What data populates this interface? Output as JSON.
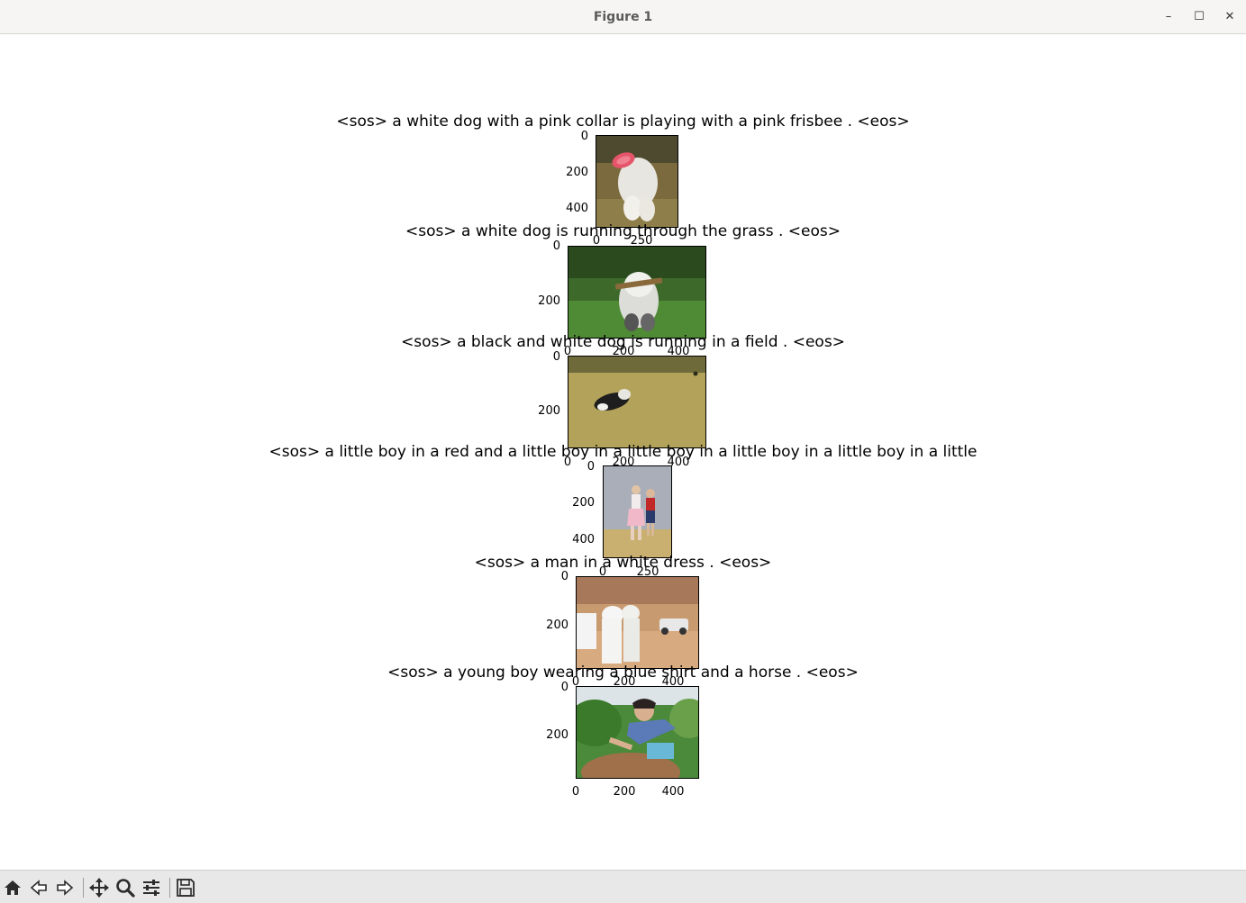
{
  "window": {
    "title": "Figure 1"
  },
  "window_controls": {
    "minimize": "–",
    "maximize": "☐",
    "close": "✕"
  },
  "panels": [
    {
      "caption": "<sos> a white dog with a pink collar is playing with a pink frisbee . <eos>",
      "y_ticks": [
        "0",
        "200",
        "400"
      ],
      "x_ticks": [
        "0",
        "250"
      ],
      "scene": "white-dog-frisbee"
    },
    {
      "caption": "<sos> a white dog is running through the grass . <eos>",
      "y_ticks": [
        "0",
        "200"
      ],
      "x_ticks": [
        "0",
        "200",
        "400"
      ],
      "scene": "dog-with-stick-grass"
    },
    {
      "caption": "<sos> a black and white dog is running in a field . <eos>",
      "y_ticks": [
        "0",
        "200"
      ],
      "x_ticks": [
        "0",
        "200",
        "400"
      ],
      "scene": "dog-running-field"
    },
    {
      "caption": "<sos> a little boy in a red and a little boy in a little boy in a little boy in a little boy in a little",
      "y_ticks": [
        "0",
        "200",
        "400"
      ],
      "x_ticks": [
        "0",
        "250"
      ],
      "scene": "kids-dancing"
    },
    {
      "caption": "<sos> a man in a white dress . <eos>",
      "y_ticks": [
        "0",
        "200"
      ],
      "x_ticks": [
        "0",
        "200",
        "400"
      ],
      "scene": "desert-men-car"
    },
    {
      "caption": "<sos> a young boy wearing a blue shirt and a horse . <eos>",
      "y_ticks": [
        "0",
        "200"
      ],
      "x_ticks": [
        "0",
        "200",
        "400"
      ],
      "scene": "boy-on-horse"
    }
  ],
  "toolbar": {
    "icons": [
      "home-icon",
      "back-icon",
      "forward-icon",
      "pan-icon",
      "zoom-icon",
      "configure-subplots-icon",
      "save-icon"
    ]
  }
}
